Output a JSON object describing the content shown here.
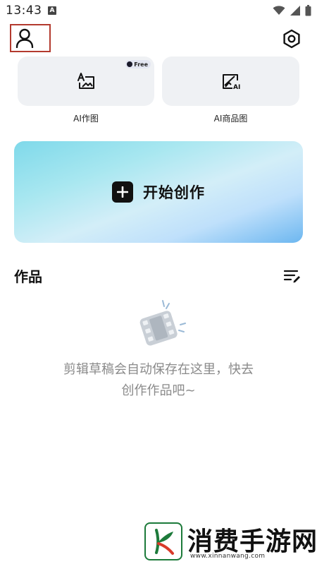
{
  "status_bar": {
    "time": "13:43",
    "notification_icon_letter": "A",
    "icons": [
      "wifi-icon",
      "signal-icon",
      "battery-icon"
    ]
  },
  "header": {
    "profile_icon": "person-icon",
    "settings_icon": "settings-icon"
  },
  "tools": [
    {
      "label": "AI作图",
      "icon": "image-text-icon",
      "badge": "Free"
    },
    {
      "label": "AI商品图",
      "icon": "ai-image-icon",
      "badge": ""
    }
  ],
  "create": {
    "label": "开始创作",
    "icon": "plus-icon"
  },
  "works": {
    "title": "作品",
    "edit_icon": "edit-list-icon",
    "empty_illustration": "film-icon",
    "empty_line1": "剪辑草稿会自动保存在这里，快去",
    "empty_line2": "创作作品吧~"
  },
  "watermark": {
    "title": "消费手游网",
    "url": "www.xinnanwang.com"
  },
  "colors": {
    "banner_start": "#7fd9ea",
    "banner_end": "#6db7f0",
    "card_bg": "#eff1f4",
    "highlight_border": "#b33a2e",
    "empty_text": "#8a8a8a",
    "watermark_green": "#1c7a3a"
  }
}
